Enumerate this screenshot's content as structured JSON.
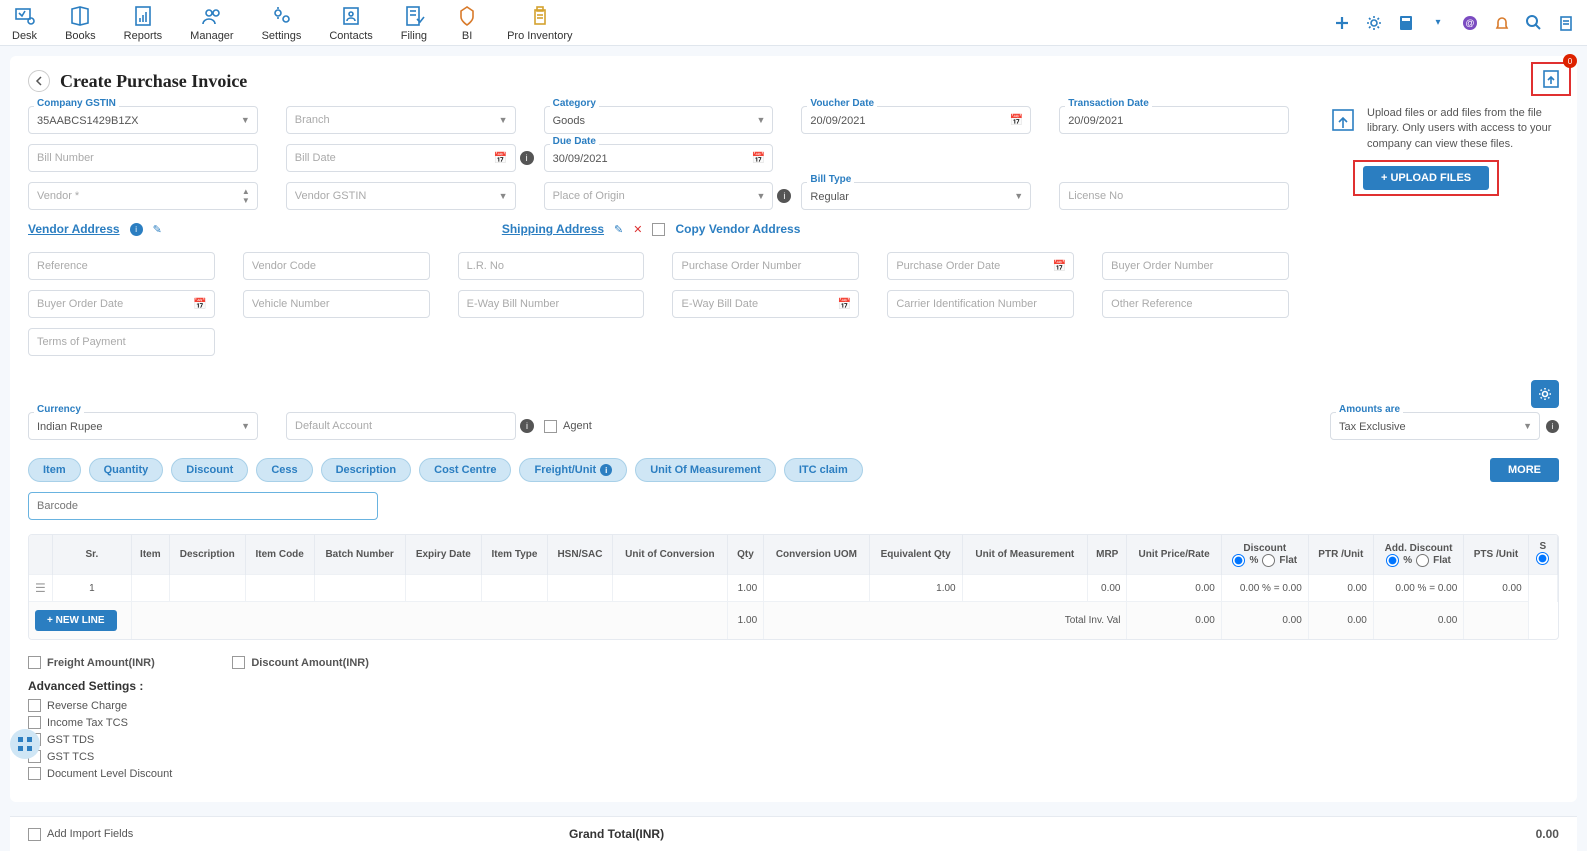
{
  "nav": {
    "items": [
      "Desk",
      "Books",
      "Reports",
      "Manager",
      "Settings",
      "Contacts",
      "Filing",
      "BI",
      "Pro Inventory"
    ]
  },
  "header": {
    "title": "Create Purchase Invoice"
  },
  "upload": {
    "text": "Upload files or add files from the file library. Only users with access to your company can view these files.",
    "btn": "+ UPLOAD FILES",
    "badge": "0"
  },
  "form": {
    "gstin_label": "Company GSTIN",
    "gstin": "35AABCS1429B1ZX",
    "branch_ph": "Branch",
    "category_label": "Category",
    "category": "Goods",
    "voucher_label": "Voucher Date",
    "voucher": "20/09/2021",
    "trans_label": "Transaction Date",
    "trans": "20/09/2021",
    "bill_no_ph": "Bill Number",
    "bill_date_ph": "Bill Date",
    "due_label": "Due Date",
    "due": "30/09/2021",
    "vendor_ph": "Vendor *",
    "vendor_gstin_ph": "Vendor GSTIN",
    "place_ph": "Place of Origin",
    "billtype_label": "Bill Type",
    "billtype": "Regular",
    "license_ph": "License No",
    "vendor_addr": "Vendor Address",
    "ship_addr": "Shipping Address",
    "copy_addr": "Copy Vendor Address",
    "reference_ph": "Reference",
    "vendor_code_ph": "Vendor Code",
    "lr_ph": "L.R. No",
    "po_no_ph": "Purchase Order Number",
    "po_date_ph": "Purchase Order Date",
    "buyer_no_ph": "Buyer Order Number",
    "buyer_date_ph": "Buyer Order Date",
    "vehicle_ph": "Vehicle Number",
    "eway_ph": "E-Way Bill Number",
    "eway_date_ph": "E-Way Bill Date",
    "carrier_ph": "Carrier Identification Number",
    "other_ref_ph": "Other Reference",
    "terms_ph": "Terms of Payment",
    "currency_label": "Currency",
    "currency": "Indian Rupee",
    "default_acc_ph": "Default Account",
    "agent": "Agent",
    "amounts_label": "Amounts are",
    "amounts": "Tax Exclusive"
  },
  "pills": [
    "Item",
    "Quantity",
    "Discount",
    "Cess",
    "Description",
    "Cost Centre",
    "Freight/Unit",
    "Unit Of Measurement",
    "ITC claim"
  ],
  "more": "MORE",
  "barcode_ph": "Barcode",
  "table": {
    "headers": [
      "Sr.",
      "Item",
      "Description",
      "Item Code",
      "Batch Number",
      "Expiry Date",
      "Item Type",
      "HSN/SAC",
      "Unit of Conversion",
      "Qty",
      "Conversion UOM",
      "Equivalent Qty",
      "Unit of Measurement",
      "MRP",
      "Unit Price/Rate",
      "Discount",
      "PTR /Unit",
      "Add. Discount",
      "PTS /Unit",
      "S"
    ],
    "pct": "%",
    "flat": "Flat",
    "row": {
      "sr": "1",
      "qty": "1.00",
      "eqty": "1.00",
      "mrp": "0.00",
      "rate": "0.00",
      "disc": "0.00 % = 0.00",
      "ptr": "0.00",
      "adisc": "0.00 % = 0.00",
      "pts": "0.00"
    },
    "newline": "+ NEW LINE",
    "total_qty": "1.00",
    "total_label": "Total Inv. Val",
    "z1": "0.00",
    "z2": "0.00",
    "z3": "0.00",
    "z4": "0.00"
  },
  "bottom": {
    "freight": "Freight Amount(INR)",
    "discount": "Discount Amount(INR)",
    "advanced": "Advanced Settings :",
    "reverse": "Reverse Charge",
    "tcs": "Income Tax TCS",
    "gsttds": "GST TDS",
    "gsttcs": "GST TCS",
    "docdisc": "Document Level Discount",
    "addimport": "Add Import Fields",
    "grand": "Grand Total(INR)",
    "grandval": "0.00"
  }
}
